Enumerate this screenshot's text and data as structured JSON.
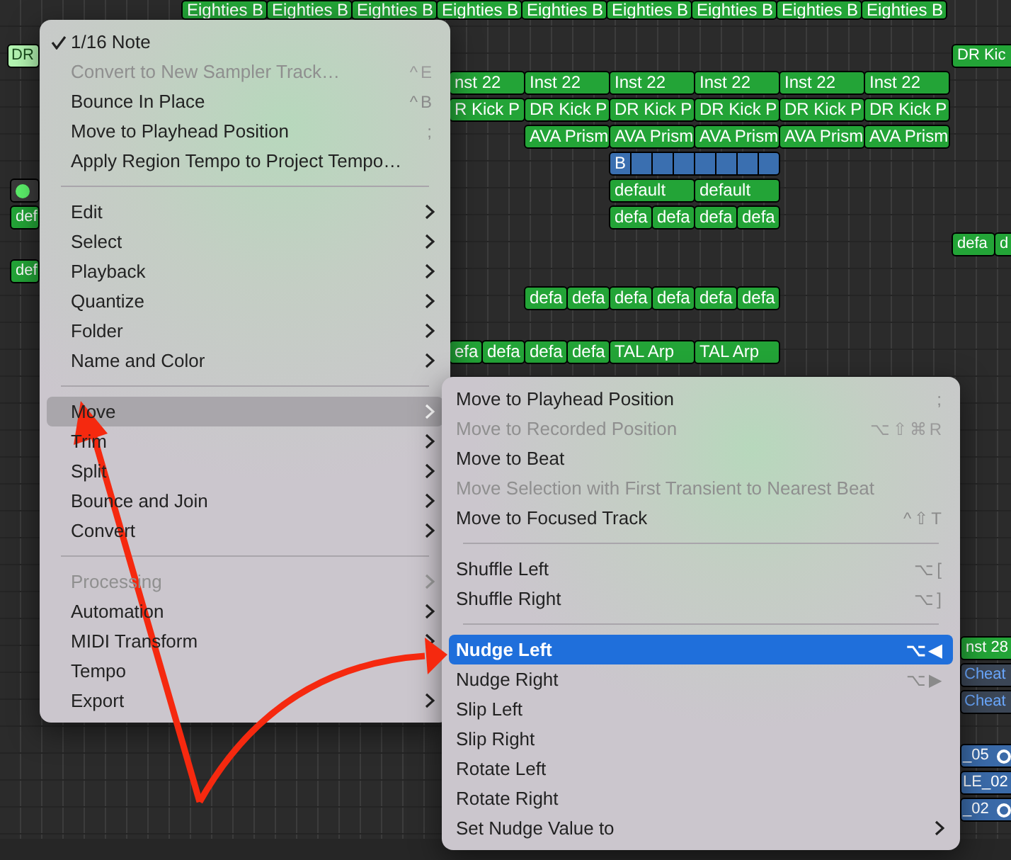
{
  "tracks": [
    {
      "regions": [
        {
          "label": "Eighties B",
          "kind": "midi"
        },
        {
          "label": "Eighties B",
          "kind": "midi"
        },
        {
          "label": "Eighties B",
          "kind": "midi"
        },
        {
          "label": "Eighties B",
          "kind": "midi"
        },
        {
          "label": "Eighties B",
          "kind": "midi"
        },
        {
          "label": "Eighties B",
          "kind": "midi"
        },
        {
          "label": "Eighties B",
          "kind": "midi"
        },
        {
          "label": "Eighties B",
          "kind": "midi"
        },
        {
          "label": "Eighties B",
          "kind": "midi"
        }
      ]
    },
    {
      "regions": [
        {
          "label": "DR",
          "kind": "selected"
        },
        {
          "label": "DR Kic",
          "kind": "midi"
        }
      ]
    },
    {
      "regions": [
        {
          "label": "nst 22",
          "kind": "midi"
        },
        {
          "label": "Inst 22",
          "kind": "midi"
        },
        {
          "label": "Inst 22",
          "kind": "midi"
        },
        {
          "label": "Inst 22",
          "kind": "midi"
        },
        {
          "label": "Inst 22",
          "kind": "midi"
        },
        {
          "label": "Inst 22",
          "kind": "midi"
        }
      ]
    },
    {
      "regions": [
        {
          "label": "R Kick P",
          "kind": "midi"
        },
        {
          "label": "DR Kick P",
          "kind": "midi"
        },
        {
          "label": "DR Kick P",
          "kind": "midi"
        },
        {
          "label": "DR Kick P",
          "kind": "midi"
        },
        {
          "label": "DR Kick P",
          "kind": "midi"
        },
        {
          "label": "DR Kick P",
          "kind": "midi"
        }
      ]
    },
    {
      "regions": [
        {
          "label": "AVA Prism",
          "kind": "midi"
        },
        {
          "label": "AVA Prism",
          "kind": "midi"
        },
        {
          "label": "AVA Prism",
          "kind": "midi"
        },
        {
          "label": "AVA Prism",
          "kind": "midi"
        },
        {
          "label": "AVA Prism",
          "kind": "midi"
        }
      ]
    },
    {
      "regions": [
        {
          "label": "B",
          "kind": "pattern"
        }
      ]
    },
    {
      "regions": [
        {
          "kind": "dot"
        },
        {
          "label": "default",
          "kind": "midi"
        },
        {
          "label": "default",
          "kind": "midi"
        }
      ]
    },
    {
      "regions": [
        {
          "label": "def",
          "kind": "midi"
        },
        {
          "label": "defa",
          "kind": "midi"
        },
        {
          "label": "defa",
          "kind": "midi"
        },
        {
          "label": "defa",
          "kind": "midi"
        },
        {
          "label": "defa",
          "kind": "midi"
        }
      ]
    },
    {
      "regions": [
        {
          "label": "defa",
          "kind": "midi"
        },
        {
          "label": "d",
          "kind": "midi"
        }
      ]
    },
    {
      "regions": [
        {
          "label": "def",
          "kind": "midi"
        }
      ]
    },
    {
      "regions": [
        {
          "label": "defa",
          "kind": "midi"
        },
        {
          "label": "defa",
          "kind": "midi"
        },
        {
          "label": "defa",
          "kind": "midi"
        },
        {
          "label": "defa",
          "kind": "midi"
        },
        {
          "label": "defa",
          "kind": "midi"
        },
        {
          "label": "defa",
          "kind": "midi"
        }
      ]
    },
    {
      "regions": [
        {
          "label": "efa",
          "kind": "midi"
        },
        {
          "label": "defa",
          "kind": "midi"
        },
        {
          "label": "defa",
          "kind": "midi"
        },
        {
          "label": "defa",
          "kind": "midi"
        },
        {
          "label": "TAL Arp",
          "kind": "midi"
        },
        {
          "label": "TAL Arp",
          "kind": "midi"
        }
      ]
    },
    {
      "regions": [
        {
          "label": "nst 28",
          "kind": "midi"
        }
      ]
    },
    {
      "regions": [
        {
          "label": "Cheat",
          "kind": "cheat"
        }
      ]
    },
    {
      "regions": [
        {
          "label": "Cheat",
          "kind": "cheat"
        }
      ]
    },
    {
      "regions": [
        {
          "label": "_05",
          "kind": "audio_loop"
        }
      ]
    },
    {
      "regions": [
        {
          "label": "LE_02",
          "kind": "audio"
        }
      ]
    },
    {
      "regions": [
        {
          "label": "_02",
          "kind": "audio_loop"
        }
      ]
    }
  ],
  "context_menu": {
    "items": [
      {
        "kind": "item",
        "label": "1/16 Note",
        "checked": true,
        "disabled": false,
        "selected": false,
        "submenu": false
      },
      {
        "kind": "item",
        "label": "Convert to New Sampler Track…",
        "shortcut": "^E",
        "checked": false,
        "disabled": true,
        "selected": false,
        "submenu": false
      },
      {
        "kind": "item",
        "label": "Bounce In Place",
        "shortcut": "^B",
        "checked": false,
        "disabled": false,
        "selected": false,
        "submenu": false
      },
      {
        "kind": "item",
        "label": "Move to Playhead Position",
        "shortcut": ";",
        "checked": false,
        "disabled": false,
        "selected": false,
        "submenu": false
      },
      {
        "kind": "item",
        "label": "Apply Region Tempo to Project Tempo…",
        "checked": false,
        "disabled": false,
        "selected": false,
        "submenu": false
      },
      {
        "kind": "separator"
      },
      {
        "kind": "item",
        "label": "Edit",
        "checked": false,
        "disabled": false,
        "selected": false,
        "submenu": true
      },
      {
        "kind": "item",
        "label": "Select",
        "checked": false,
        "disabled": false,
        "selected": false,
        "submenu": true
      },
      {
        "kind": "item",
        "label": "Playback",
        "checked": false,
        "disabled": false,
        "selected": false,
        "submenu": true
      },
      {
        "kind": "item",
        "label": "Quantize",
        "checked": false,
        "disabled": false,
        "selected": false,
        "submenu": true
      },
      {
        "kind": "item",
        "label": "Folder",
        "checked": false,
        "disabled": false,
        "selected": false,
        "submenu": true
      },
      {
        "kind": "item",
        "label": "Name and Color",
        "checked": false,
        "disabled": false,
        "selected": false,
        "submenu": true
      },
      {
        "kind": "separator"
      },
      {
        "kind": "item",
        "label": "Move",
        "checked": false,
        "disabled": false,
        "selected": true,
        "submenu": true
      },
      {
        "kind": "item",
        "label": "Trim",
        "checked": false,
        "disabled": false,
        "selected": false,
        "submenu": true
      },
      {
        "kind": "item",
        "label": "Split",
        "checked": false,
        "disabled": false,
        "selected": false,
        "submenu": true
      },
      {
        "kind": "item",
        "label": "Bounce and Join",
        "checked": false,
        "disabled": false,
        "selected": false,
        "submenu": true
      },
      {
        "kind": "item",
        "label": "Convert",
        "checked": false,
        "disabled": false,
        "selected": false,
        "submenu": true
      },
      {
        "kind": "separator"
      },
      {
        "kind": "item",
        "label": "Processing",
        "checked": false,
        "disabled": true,
        "selected": false,
        "submenu": true
      },
      {
        "kind": "item",
        "label": "Automation",
        "checked": false,
        "disabled": false,
        "selected": false,
        "submenu": true
      },
      {
        "kind": "item",
        "label": "MIDI Transform",
        "checked": false,
        "disabled": false,
        "selected": false,
        "submenu": true
      },
      {
        "kind": "item",
        "label": "Tempo",
        "checked": false,
        "disabled": false,
        "selected": false,
        "submenu": false
      },
      {
        "kind": "item",
        "label": "Export",
        "checked": false,
        "disabled": false,
        "selected": false,
        "submenu": true
      }
    ]
  },
  "move_submenu": {
    "items": [
      {
        "kind": "item",
        "label": "Move to Playhead Position",
        "shortcut": ";",
        "disabled": false,
        "selected": false,
        "submenu": false
      },
      {
        "kind": "item",
        "label": "Move to Recorded Position",
        "shortcut": "⌥⇧⌘R",
        "disabled": true,
        "selected": false,
        "submenu": false
      },
      {
        "kind": "item",
        "label": "Move to Beat",
        "disabled": false,
        "selected": false,
        "submenu": false
      },
      {
        "kind": "item",
        "label": "Move Selection with First Transient to Nearest Beat",
        "disabled": true,
        "selected": false,
        "submenu": false
      },
      {
        "kind": "item",
        "label": "Move to Focused Track",
        "shortcut": "^⇧T",
        "disabled": false,
        "selected": false,
        "submenu": false
      },
      {
        "kind": "separator"
      },
      {
        "kind": "item",
        "label": "Shuffle Left",
        "shortcut": "⌥[",
        "disabled": false,
        "selected": false,
        "submenu": false
      },
      {
        "kind": "item",
        "label": "Shuffle Right",
        "shortcut": "⌥]",
        "disabled": false,
        "selected": false,
        "submenu": false
      },
      {
        "kind": "separator"
      },
      {
        "kind": "item",
        "label": "Nudge Left",
        "shortcut": "⌥◀",
        "disabled": false,
        "selected": true,
        "submenu": false
      },
      {
        "kind": "item",
        "label": "Nudge Right",
        "shortcut": "⌥▶",
        "disabled": false,
        "selected": false,
        "submenu": false
      },
      {
        "kind": "item",
        "label": "Slip Left",
        "disabled": false,
        "selected": false,
        "submenu": false
      },
      {
        "kind": "item",
        "label": "Slip Right",
        "disabled": false,
        "selected": false,
        "submenu": false
      },
      {
        "kind": "item",
        "label": "Rotate Left",
        "disabled": false,
        "selected": false,
        "submenu": false
      },
      {
        "kind": "item",
        "label": "Rotate Right",
        "disabled": false,
        "selected": false,
        "submenu": false
      },
      {
        "kind": "item",
        "label": "Set Nudge Value to",
        "disabled": false,
        "selected": false,
        "submenu": true
      }
    ]
  }
}
